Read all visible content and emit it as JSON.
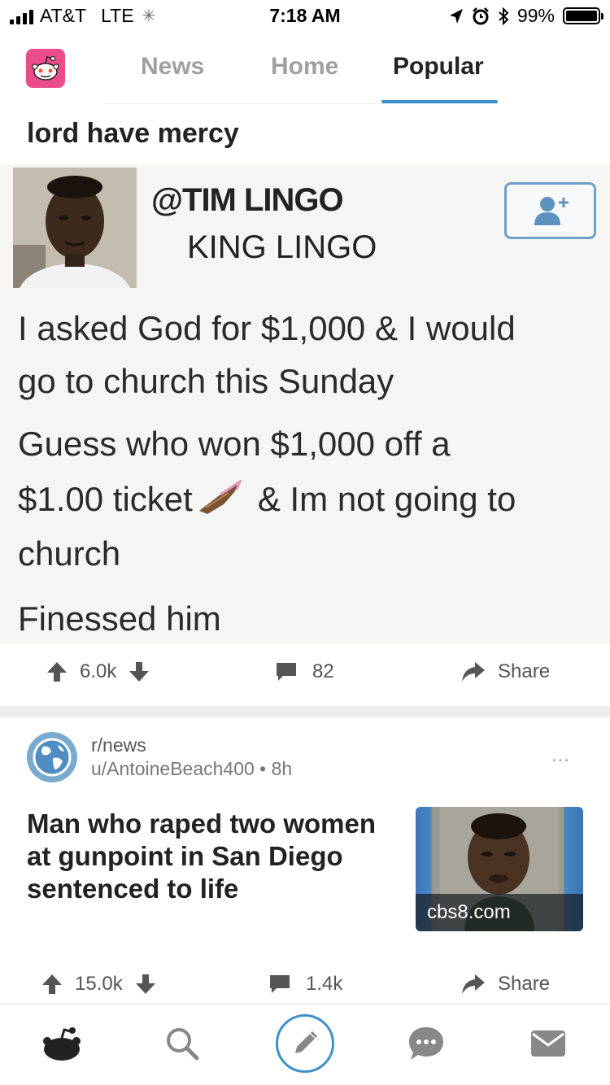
{
  "status_bar": {
    "carrier": "AT&T",
    "network": "LTE",
    "time": "7:18 AM",
    "battery_percent": "99%",
    "battery_level": 0.99,
    "signal_bars": 4,
    "icons": [
      "location-icon",
      "alarm-icon",
      "bluetooth-icon"
    ]
  },
  "header": {
    "logo_icon": "reddit-snoo-icon",
    "tabs": [
      {
        "label": "News",
        "active": false
      },
      {
        "label": "Home",
        "active": false
      },
      {
        "label": "Popular",
        "active": true
      }
    ],
    "accent_color": "#3d90c9"
  },
  "post1": {
    "title": "lord have mercy",
    "image": {
      "handle": "@TIM LINGO",
      "display_name": "KING LINGO",
      "follow_icon": "add-user-icon",
      "lines": [
        "I asked God for $1,000 & I would",
        "go to church this Sunday",
        "Guess who won $1,000 off a",
        "$1.00 ticket",
        "& Im not going to",
        "church",
        "Finessed him"
      ],
      "emoji": "hand-rubbing-emoji"
    },
    "score": "6.0k",
    "comments": "82",
    "share_label": "Share"
  },
  "post2": {
    "subreddit": "r/news",
    "author": "u/AntoineBeach400",
    "separator": "•",
    "age": "8h",
    "more": "...",
    "title": "Man who raped two women at gunpoint in San Diego sentenced to life",
    "thumbnail_domain": "cbs8.com",
    "score": "15.0k",
    "comments": "1.4k",
    "share_label": "Share"
  },
  "bottom_nav": {
    "items": [
      "home-snoo-icon",
      "search-icon",
      "create-post-icon",
      "chat-icon",
      "inbox-icon"
    ]
  }
}
